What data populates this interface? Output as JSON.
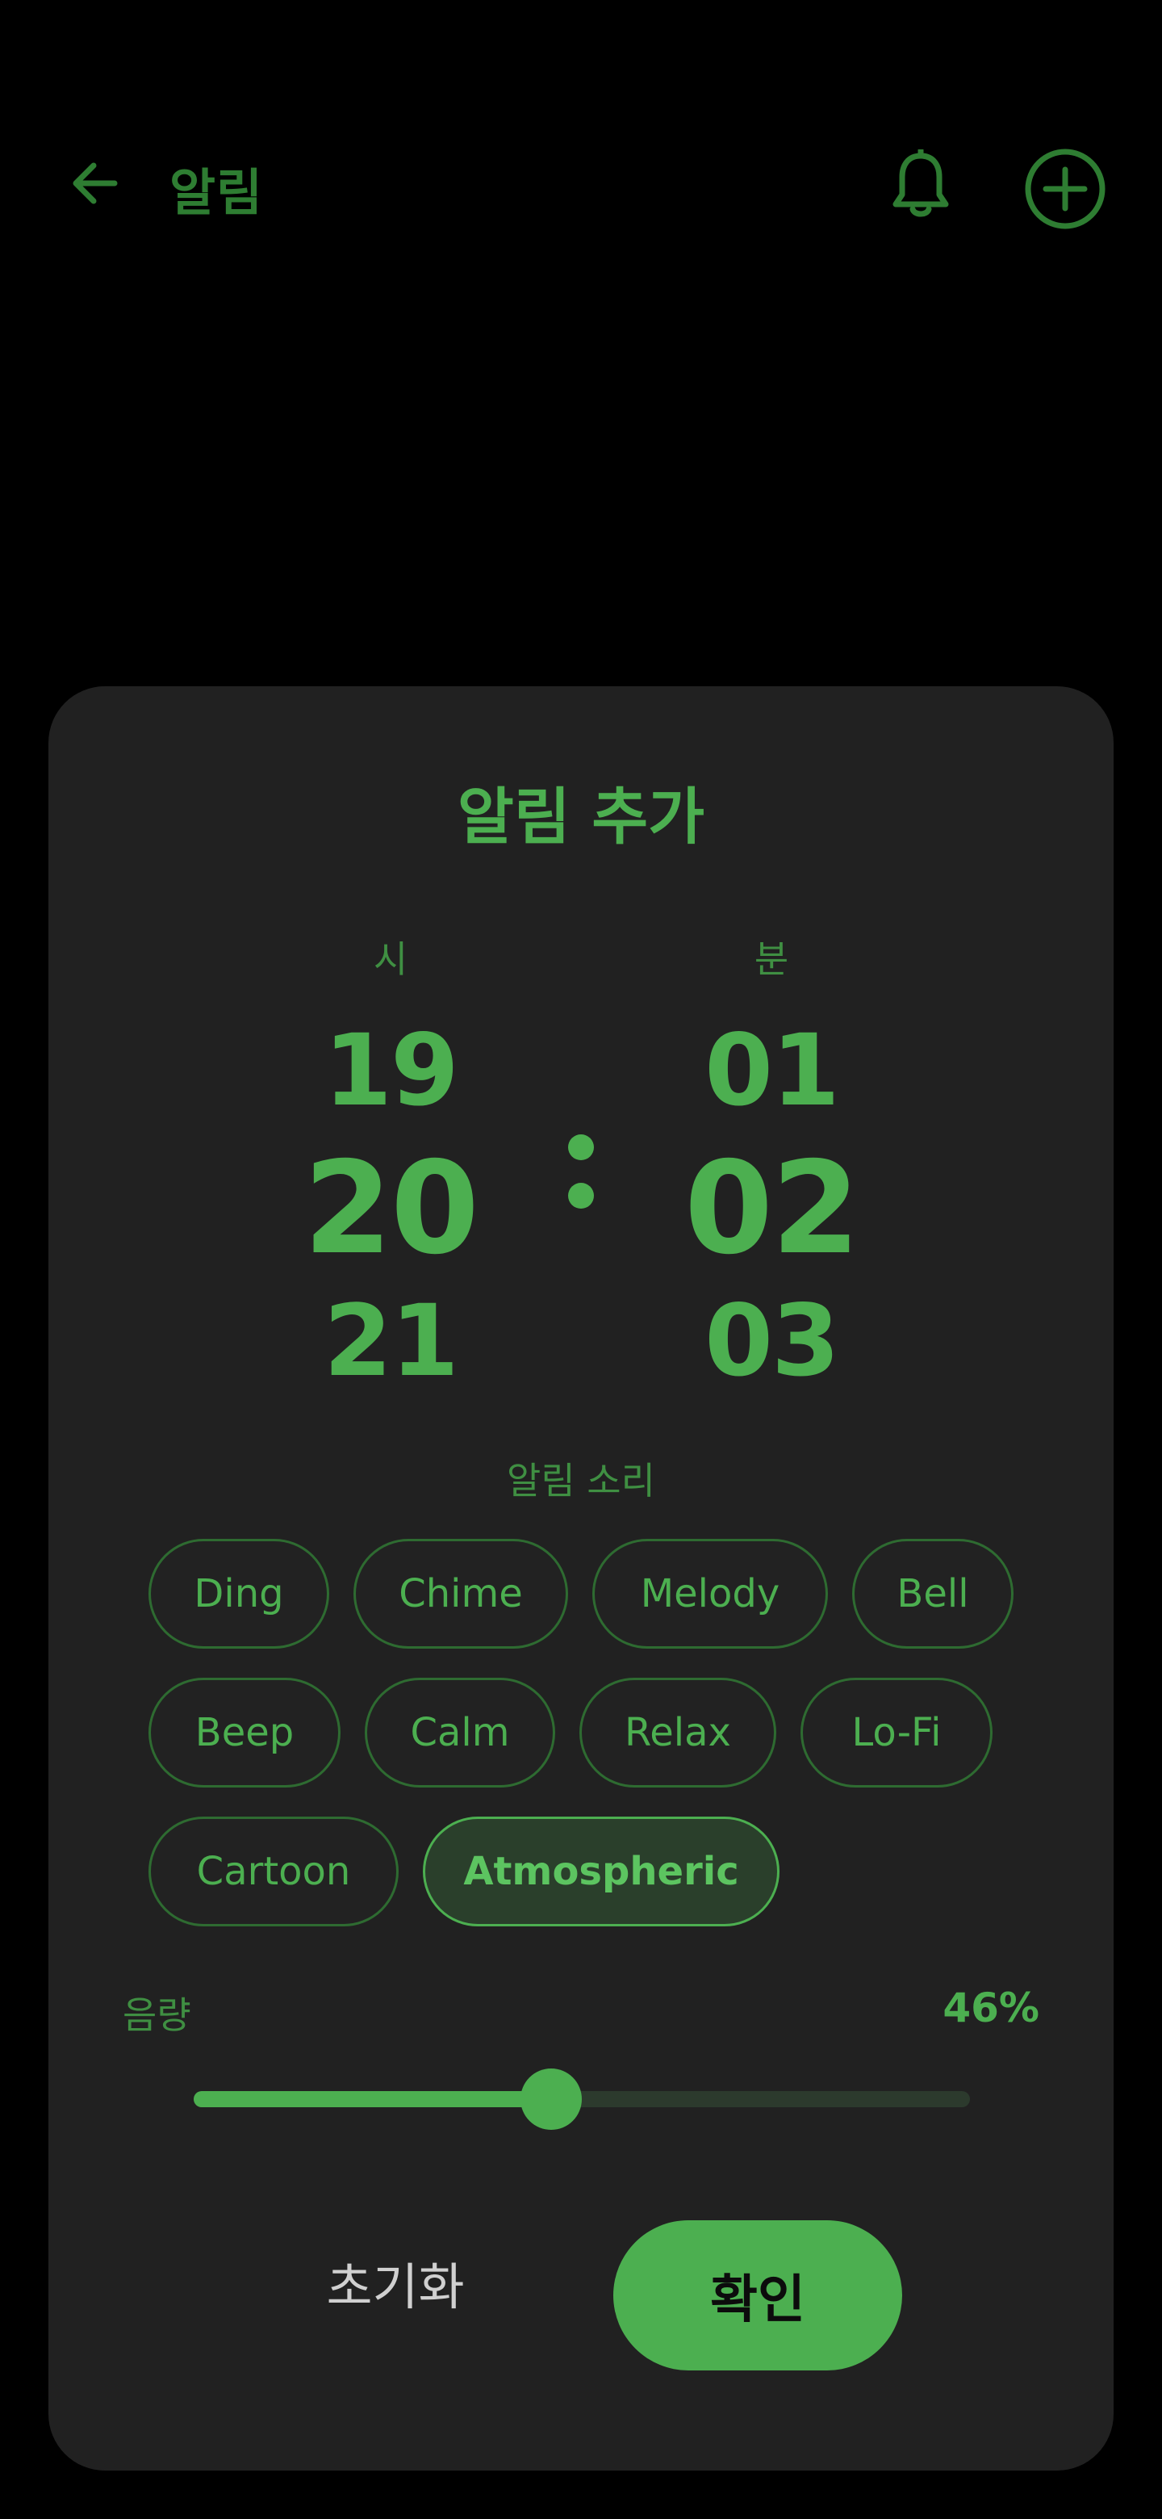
{
  "header": {
    "title": "알림",
    "back_icon": "arrow-left-icon",
    "bell_icon": "bell-icon",
    "add_icon": "plus-circle-icon"
  },
  "dialog": {
    "title": "알림 추가",
    "hour_label": "시",
    "minute_label": "분",
    "hours": {
      "prev": "19",
      "current": "20",
      "next": "21"
    },
    "minutes": {
      "prev": "01",
      "current": "02",
      "next": "03"
    },
    "sound_label": "알림 소리",
    "sounds": [
      "Ding",
      "Chime",
      "Melody",
      "Bell",
      "Beep",
      "Calm",
      "Relax",
      "Lo-Fi",
      "Cartoon",
      "Atmospheric"
    ],
    "selected_sound": "Atmospheric",
    "volume_label": "음량",
    "volume_text": "46%",
    "volume_value": 0.46,
    "reset_label": "초기화",
    "confirm_label": "확인"
  },
  "colors": {
    "accent": "#4caf50",
    "background": "#000000",
    "sheet": "#212121"
  }
}
